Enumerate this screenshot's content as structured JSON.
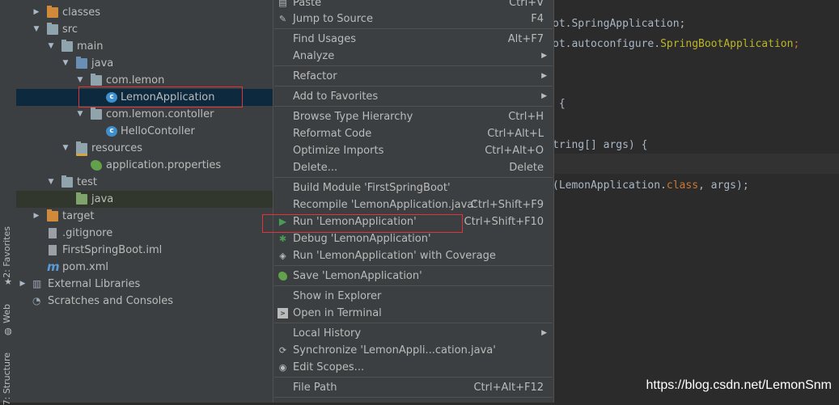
{
  "side_tabs": {
    "favorites": "2: Favorites",
    "web": "Web",
    "structure": "7: Structure"
  },
  "tree": [
    {
      "label": "classes",
      "arrow": "▶",
      "icon": "folder-orange"
    },
    {
      "label": "src",
      "arrow": "▼",
      "icon": "folder"
    },
    {
      "label": "main",
      "arrow": "▼",
      "icon": "folder"
    },
    {
      "label": "java",
      "arrow": "▼",
      "icon": "folder-blue"
    },
    {
      "label": "com.lemon",
      "arrow": "▼",
      "icon": "package"
    },
    {
      "label": "LemonApplication",
      "arrow": "",
      "icon": "spring-class"
    },
    {
      "label": "com.lemon.contoller",
      "arrow": "▼",
      "icon": "package"
    },
    {
      "label": "HelloContoller",
      "arrow": "",
      "icon": "class"
    },
    {
      "label": "resources",
      "arrow": "▼",
      "icon": "resources-folder"
    },
    {
      "label": "application.properties",
      "arrow": "",
      "icon": "spring-leaf"
    },
    {
      "label": "test",
      "arrow": "▼",
      "icon": "folder"
    },
    {
      "label": "java",
      "arrow": "",
      "icon": "folder-green"
    },
    {
      "label": "target",
      "arrow": "▶",
      "icon": "folder-orange"
    },
    {
      "label": ".gitignore",
      "arrow": "",
      "icon": "file"
    },
    {
      "label": "FirstSpringBoot.iml",
      "arrow": "",
      "icon": "file"
    },
    {
      "label": "pom.xml",
      "arrow": "",
      "icon": "maven"
    },
    {
      "label": "External Libraries",
      "arrow": "▶",
      "icon": "libraries"
    },
    {
      "label": "Scratches and Consoles",
      "arrow": "",
      "icon": "scratches"
    }
  ],
  "menu": {
    "items": [
      {
        "label": "Paste",
        "shortcut": "Ctrl+V",
        "icon": "paste-icon"
      },
      {
        "label": "Jump to Source",
        "shortcut": "F4",
        "icon": "pencil-icon"
      },
      {
        "label": "Find Usages",
        "shortcut": "Alt+F7"
      },
      {
        "label": "Analyze",
        "submenu": "▶"
      },
      {
        "label": "Refactor",
        "submenu": "▶"
      },
      {
        "label": "Add to Favorites",
        "submenu": "▶"
      },
      {
        "label": "Browse Type Hierarchy",
        "shortcut": "Ctrl+H"
      },
      {
        "label": "Reformat Code",
        "shortcut": "Ctrl+Alt+L"
      },
      {
        "label": "Optimize Imports",
        "shortcut": "Ctrl+Alt+O"
      },
      {
        "label": "Delete...",
        "shortcut": "Delete"
      },
      {
        "label": "Build Module 'FirstSpringBoot'"
      },
      {
        "label": "Recompile 'LemonApplication.java'",
        "shortcut": "Ctrl+Shift+F9"
      },
      {
        "label": "Run 'LemonApplication'",
        "shortcut": "Ctrl+Shift+F10",
        "icon": "run-icon"
      },
      {
        "label": "Debug 'LemonApplication'",
        "icon": "debug-icon"
      },
      {
        "label": "Run 'LemonApplication' with Coverage",
        "icon": "coverage-icon"
      },
      {
        "label": "Save 'LemonApplication'",
        "icon": "spring-save-icon"
      },
      {
        "label": "Show in Explorer"
      },
      {
        "label": "Open in Terminal",
        "icon": "terminal-icon"
      },
      {
        "label": "Local History",
        "submenu": "▶"
      },
      {
        "label": "Synchronize 'LemonAppli...cation.java'",
        "icon": "sync-icon"
      },
      {
        "label": "Edit Scopes...",
        "icon": "scopes-icon"
      },
      {
        "label": "File Path",
        "shortcut": "Ctrl+Alt+F12"
      }
    ]
  },
  "code": {
    "line1": "ot.SpringApplication;",
    "line2_a": "ot.autoconfigure.",
    "line2_b": "SpringBootApplication",
    "line2_c": ";",
    "line3": " {",
    "line4": "tring[] args) {",
    "line5_a": "(LemonApplication.",
    "line5_b": "class",
    "line5_c": ", args);"
  },
  "watermark": "https://blog.csdn.net/LemonSnm",
  "colors": {
    "keyword": "#cc7832",
    "annotation": "#bbb529",
    "highlight_box": "#e0333a"
  }
}
